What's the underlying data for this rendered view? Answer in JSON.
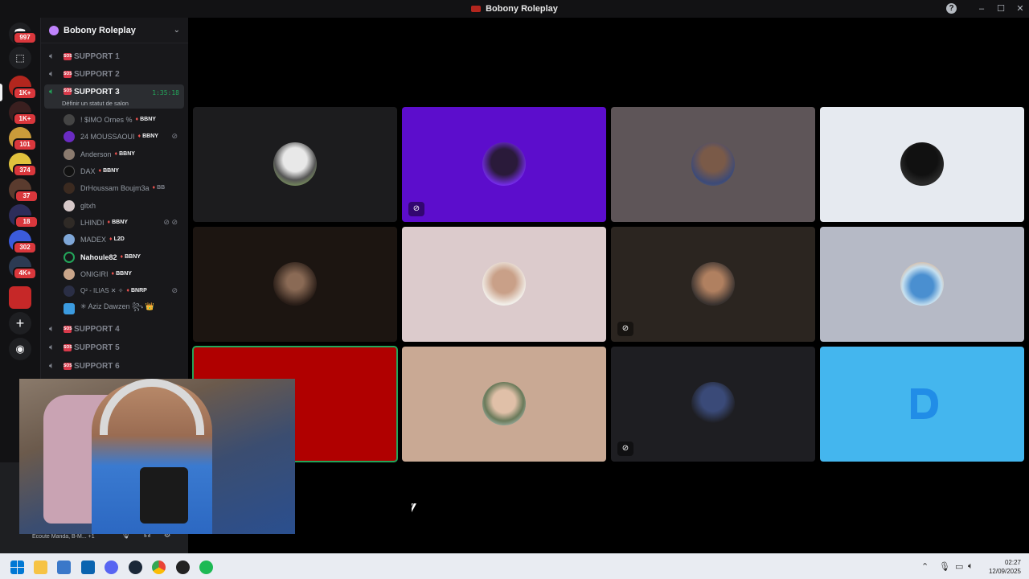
{
  "window": {
    "title": "Bobony Roleplay"
  },
  "rail": {
    "badges": [
      "997",
      "1K+",
      "1K+",
      "101",
      "374",
      "37",
      "18",
      "302",
      "4K+"
    ]
  },
  "sidebar": {
    "guild_name": "Bobony Roleplay",
    "channels_top": [
      {
        "label": "SUPPORT 1"
      },
      {
        "label": "SUPPORT 2"
      }
    ],
    "active_channel": {
      "label": "SUPPORT 3",
      "timer": "1:35:18",
      "status": "Définir un statut de salon"
    },
    "members": [
      {
        "name": "! $IMO Ornes %",
        "tag": "BBNY",
        "bold": false
      },
      {
        "name": "24 MOUSSAOUI",
        "tag": "BBNY",
        "bold": false
      },
      {
        "name": "Anderson",
        "tag": "BBNY",
        "bold": false
      },
      {
        "name": "DAX",
        "tag": "BBNY",
        "bold": false
      },
      {
        "name": "DrHoussam Boujm3a",
        "tag": "BB",
        "bold": false
      },
      {
        "name": "gltxh",
        "tag": "",
        "bold": false
      },
      {
        "name": "LHINDI",
        "tag": "BBNY",
        "bold": false
      },
      {
        "name": "MADEX",
        "tag": "L2D",
        "bold": false
      },
      {
        "name": "Nahoule82",
        "tag": "BBNY",
        "bold": true
      },
      {
        "name": "ONIGIRI",
        "tag": "BBNY",
        "bold": false
      },
      {
        "name": "Q² - ILIAS ✕ ✧",
        "tag": "BNRP",
        "bold": false
      },
      {
        "name": "✳ Aziz Dawzen ꧂ 👑",
        "tag": "",
        "bold": false
      }
    ],
    "channels_bottom": [
      {
        "label": "SUPPORT 4"
      },
      {
        "label": "SUPPORT 5"
      },
      {
        "label": "SUPPORT 6"
      }
    ],
    "listening": "Écoute Manda, B-M... +1"
  },
  "taskbar": {
    "time": "02:27",
    "date": "12/09/2025"
  },
  "colors": {
    "speaking": "#23a55a",
    "badge": "#da373c",
    "accent": "#5865f2"
  }
}
